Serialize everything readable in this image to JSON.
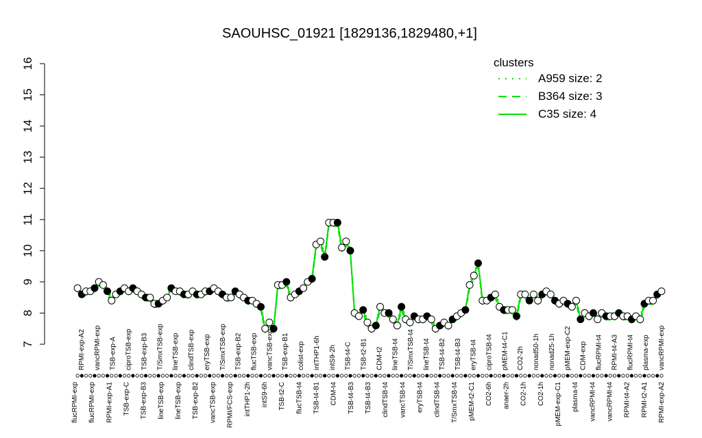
{
  "chart_data": {
    "type": "line",
    "title": "SAOUHSC_01921 [1829136,1829480,+1]",
    "xlabel": "",
    "ylabel": "",
    "ylim": [
      7,
      16
    ],
    "yticks": [
      7,
      8,
      9,
      10,
      11,
      12,
      13,
      14,
      15,
      16
    ],
    "grid": false,
    "legend": {
      "placement": "top-right",
      "title": "clusters",
      "entries": [
        {
          "label": "A959 size: 2",
          "style": "dotted"
        },
        {
          "label": "B364 size: 3",
          "style": "dashed"
        },
        {
          "label": "C35 size: 4",
          "style": "solid"
        }
      ]
    },
    "colors": {
      "line": "#00e000",
      "legend_title": "#00e000",
      "point_stroke": "#000000"
    },
    "top_labels": [
      "RPMI-exp-A2",
      "vancRPMI-exp",
      "TSB-exp-A",
      "ciproTSB-exp",
      "TSB-exp-B3",
      "T/SmxTSB-exp",
      "lineTSB-exp",
      "clindTSB-exp",
      "eryTSB-exp",
      "T/SmxTSB-exp",
      "TSB-exp-B2",
      "flucTSB-exp",
      "vancTSB-exp",
      "TSB-exp-B1",
      "colist-exp",
      "intTHP1-6h",
      "intS9-2h",
      "TSB-t4-C",
      "TSB-t2-B1",
      "CDM-t2",
      "lineTSB-t4",
      "T/SmxTSB-t4",
      "lineTSB-t4",
      "TSB-t4-B2",
      "TSB-t4-B3",
      "eryTSB-t4",
      "ciproTSB-t4",
      "pMEM-t4-C1",
      "CO2-2h",
      "nonad50-1h",
      "nonad25-1h",
      "pMEM-exp-C2",
      "CDM-exp",
      "flucRPMI-t4",
      "RPMI-t4-A3",
      "flucRPMI-t4",
      "plasma-exp",
      "vancRPMI-exp"
    ],
    "bottom_labels": [
      "flucRPMI-exp",
      "flucRPMI-exp",
      "RPMI-exp-A1",
      "TSB-exp-C",
      "TSB-exp-B3",
      "lineTSB-exp",
      "lineTSB-exp",
      "TSB-exp-B2",
      "vancTSB-exp",
      "RPMI/FCS-exp",
      "intTHP1-2h",
      "intS9-6h",
      "TSB-t2-C",
      "flucTSB-t4",
      "TSB-t4-B1",
      "CDM-t4",
      "TSB-t4-B3",
      "TSB-t4-B3",
      "clindTSB-t4",
      "vancTSB-t4",
      "eryTSB-t4",
      "clindTSB-t4",
      "T/SmxTSB-t4",
      "pMEM-t2-C1",
      "CO2-6h",
      "anaer-2h",
      "CO2-1h",
      "CO2-1h",
      "pMEM-exp-C1",
      "plasma-t4",
      "vancRPMI-t4",
      "vancRPMI-t4",
      "RPMI-t4-A2",
      "RPMI-t2-A1",
      "RPMI-exp-A2"
    ],
    "series": [
      {
        "values": [
          8.8,
          8.6,
          8.7,
          8.7,
          8.8,
          9.0,
          8.9,
          8.7,
          8.4,
          8.6,
          8.7,
          8.8,
          8.7,
          8.8,
          8.7,
          8.6,
          8.5,
          8.5,
          8.3,
          8.3,
          8.4,
          8.5,
          8.8,
          8.7,
          8.7,
          8.6,
          8.6,
          8.7,
          8.6,
          8.6,
          8.7,
          8.7,
          8.8,
          8.7,
          8.6,
          8.5,
          8.5,
          8.7,
          8.6,
          8.5,
          8.4,
          8.4,
          8.3,
          8.2,
          7.5,
          7.7,
          7.5,
          8.9,
          8.9,
          9.0,
          8.5,
          8.6,
          8.7,
          8.8,
          9.0,
          9.1,
          10.2,
          10.3,
          9.8,
          10.9,
          10.9,
          10.9,
          10.1,
          10.3,
          10.0,
          8.0,
          7.9,
          8.1,
          7.7,
          7.5,
          7.6,
          8.2,
          8.0,
          8.0,
          7.8,
          7.6,
          8.2,
          7.8,
          7.7,
          7.9,
          7.8,
          7.8,
          7.9,
          7.8,
          7.5,
          7.6,
          7.7,
          7.6,
          7.8,
          7.9,
          8.0,
          8.1,
          8.9,
          9.2,
          9.6,
          8.4,
          8.4,
          8.5,
          8.6,
          8.2,
          8.1,
          8.1,
          8.1,
          7.9,
          8.6,
          8.6,
          8.4,
          8.6,
          8.4,
          8.6,
          8.7,
          8.6,
          8.4,
          8.3,
          8.4,
          8.3,
          8.2,
          8.4,
          7.8,
          8.0,
          7.9,
          8.0,
          7.8,
          8.0,
          7.9,
          7.9,
          7.9,
          8.0,
          7.9,
          7.9,
          7.8,
          7.9,
          7.8,
          8.3,
          8.4,
          8.4,
          8.6,
          8.7
        ]
      }
    ]
  }
}
